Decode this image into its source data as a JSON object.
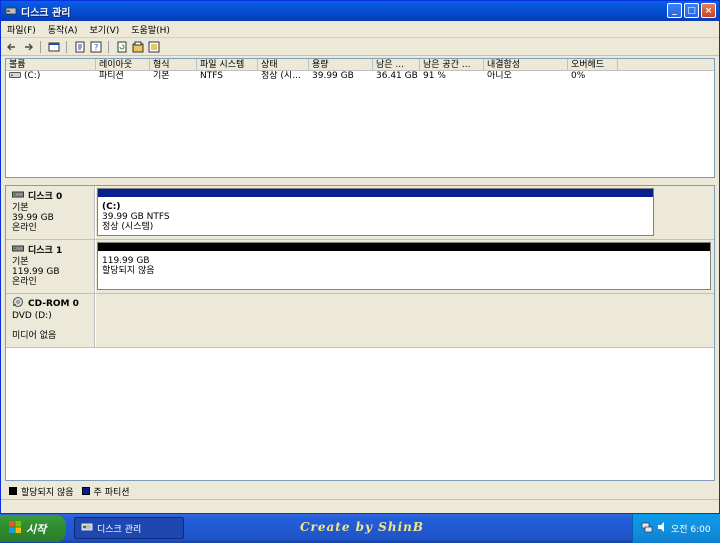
{
  "window": {
    "title": "디스크 관리",
    "controls": {
      "minimize": "_",
      "maximize": "□",
      "close": "×"
    }
  },
  "menu": [
    "파일(F)",
    "동작(A)",
    "보기(V)",
    "도움말(H)"
  ],
  "volume_list": {
    "headers": [
      "볼륨",
      "레이아웃",
      "형식",
      "파일 시스템",
      "상태",
      "용량",
      "남은 ...",
      "남은 공간 ...",
      "내결함성",
      "오버헤드"
    ],
    "rows": [
      [
        "(C:)",
        "파티션",
        "기본",
        "NTFS",
        "정상 (시...",
        "39.99 GB",
        "36.41 GB",
        "91 %",
        "아니오",
        "0%"
      ]
    ]
  },
  "disks": [
    {
      "name": "디스크 0",
      "type": "기본",
      "size": "39.99 GB",
      "status": "온라인",
      "partition": {
        "label": "(C:)",
        "detail": "39.99 GB NTFS",
        "state": "정상 (시스템)",
        "bar_color": "#0a1f8f"
      }
    },
    {
      "name": "디스크 1",
      "type": "기본",
      "size": "119.99 GB",
      "status": "온라인",
      "partition": {
        "label": "",
        "detail": "119.99 GB",
        "state": "할당되지 않음",
        "bar_color": "#000000"
      }
    },
    {
      "name": "CD-ROM 0",
      "type": "DVD (D:)",
      "size": "",
      "status": "미디어 없음"
    }
  ],
  "legend": [
    {
      "label": "할당되지 않음",
      "color": "#000000"
    },
    {
      "label": "주 파티션",
      "color": "#0a1f8f"
    }
  ],
  "taskbar": {
    "start": "시작",
    "task": "디스크 관리",
    "credit": "Create by ShinB",
    "clock": "오전 6:00"
  },
  "icons": [
    "disk-management-icon",
    "back-icon",
    "forward-icon",
    "console-icon",
    "properties-icon",
    "help-icon",
    "refresh-icon",
    "export-icon",
    "disk-drive-icon",
    "cdrom-icon",
    "windows-flag-icon",
    "network-icon"
  ]
}
